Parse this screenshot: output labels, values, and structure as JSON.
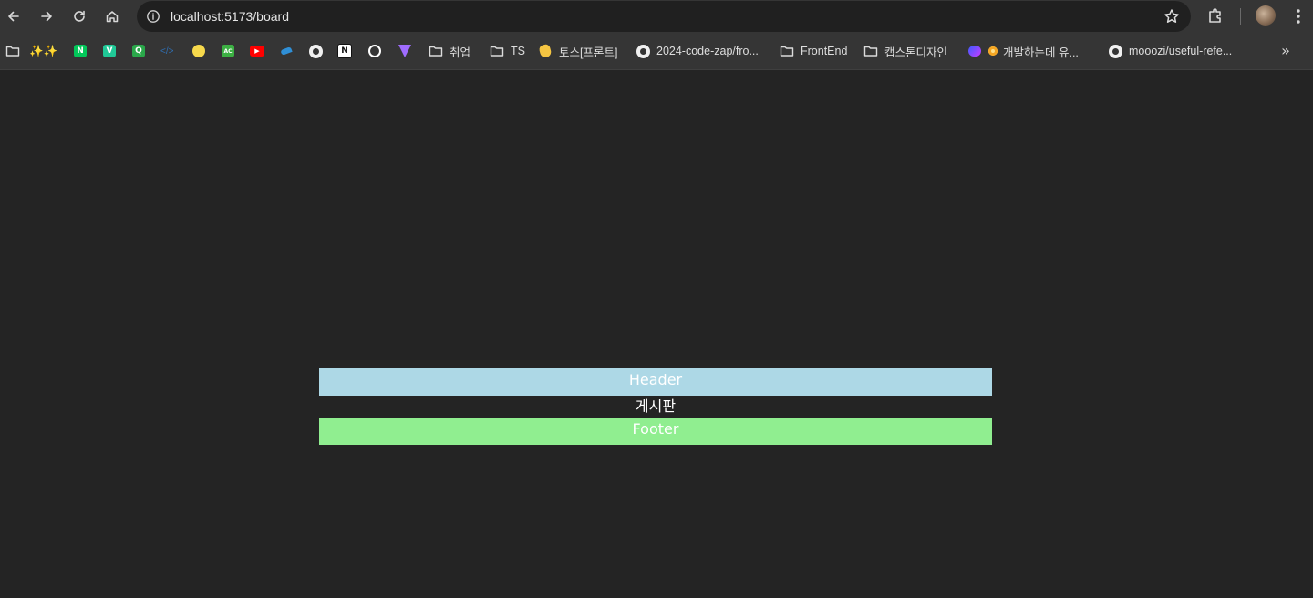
{
  "browser": {
    "url": "localhost:5173/board",
    "bookmarks": [
      {
        "name": "folder",
        "label": ""
      },
      {
        "name": "sparkles",
        "label": "✨✨"
      },
      {
        "name": "n",
        "label": "N"
      },
      {
        "name": "v",
        "label": "V"
      },
      {
        "name": "q",
        "label": "Q"
      },
      {
        "name": "code",
        "label": "</>"
      },
      {
        "name": "smile",
        "label": ""
      },
      {
        "name": "ac",
        "label": "AC"
      },
      {
        "name": "youtube",
        "label": ""
      },
      {
        "name": "bird",
        "label": ""
      },
      {
        "name": "github",
        "label": ""
      },
      {
        "name": "notion",
        "label": "N"
      },
      {
        "name": "openai",
        "label": ""
      },
      {
        "name": "vite",
        "label": ""
      },
      {
        "name": "folder-job",
        "label": "취업"
      },
      {
        "name": "folder-ts",
        "label": "TS"
      },
      {
        "name": "toss",
        "label": "토스[프론트]"
      },
      {
        "name": "github-codezap",
        "label": "2024-code-zap/fro..."
      },
      {
        "name": "folder-frontend",
        "label": "FrontEnd"
      },
      {
        "name": "folder-capstone",
        "label": "캡스톤디자인"
      },
      {
        "name": "dev-blog",
        "label": "개발하는데 유..."
      },
      {
        "name": "github-mooozi",
        "label": "mooozi/useful-refe..."
      }
    ],
    "colors": {
      "toolbar": "#353535",
      "omnibox": "#202020",
      "page_bg": "#242424"
    }
  },
  "page": {
    "header": "Header",
    "board_title": "게시판",
    "footer": "Footer",
    "colors": {
      "header_bg": "#add8e6",
      "footer_bg": "#90ee90"
    }
  }
}
